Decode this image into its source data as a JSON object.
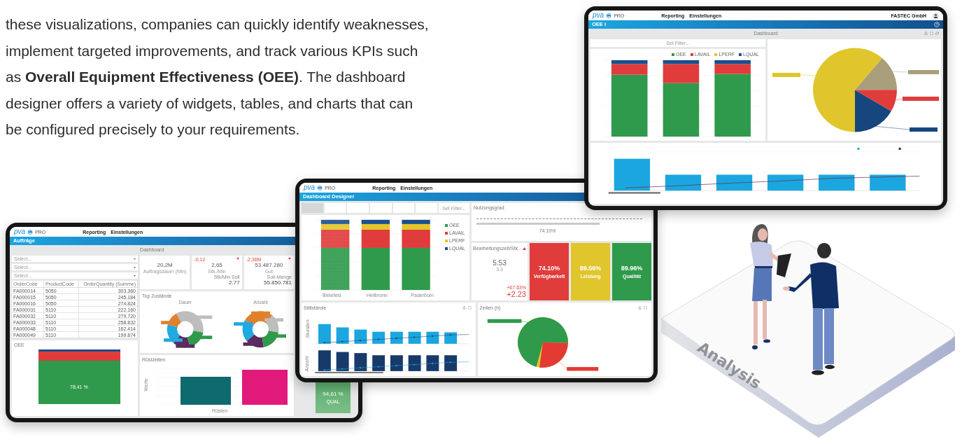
{
  "intro": {
    "lines": [
      "these visualizations, companies can quickly identify weaknesses,",
      "implement targeted improvements, and track various KPIs such",
      "as **Overall Equipment Effectiveness (OEE)**. The dashboard",
      "designer offers a variety of widgets, tables, and charts that can",
      "be configured precisely to your requirements."
    ]
  },
  "oee_tablet": {
    "header": {
      "logo": [
        "pva",
        "PRO"
      ],
      "menu": [
        "Reporting",
        "Einstellungen"
      ],
      "company": "FASTEC GmbH"
    },
    "title": "OEE I",
    "dashboard_label": "Dashboard",
    "filter": {
      "placeholder": "Set Filter..."
    },
    "legend": [
      {
        "name": "OEE",
        "color": "#2f9a4c"
      },
      {
        "name": "LAVAIL",
        "color": "#e03c3c"
      },
      {
        "name": "LPERF",
        "color": "#e3c62a"
      },
      {
        "name": "LQUAL",
        "color": "#1a4f8f"
      }
    ]
  },
  "designer_tablet": {
    "header": {
      "logo": [
        "pva",
        "PRO"
      ],
      "menu": [
        "Reporting",
        "Einstellungen"
      ]
    },
    "title": "Dashboard Designer",
    "filters": [
      {
        "selected": true
      },
      {
        "selected": false
      },
      {
        "selected": false
      },
      {
        "selected": false
      },
      {
        "selected": false
      },
      {
        "selected": false
      }
    ],
    "filter_field": {
      "placeholder": "Set Filter..."
    },
    "legend": [
      {
        "name": "OEE",
        "color": "#2f9a4c"
      },
      {
        "name": "LAVAIL",
        "color": "#e03c3c"
      },
      {
        "name": "LPERF",
        "color": "#e3c62a"
      },
      {
        "name": "LQUAL",
        "color": "#1a4f8f"
      }
    ],
    "categories": [
      "Bielefeld",
      "Heilbronn",
      "Paderborn"
    ],
    "gauge": {
      "title": "Nutzungsgrad",
      "level": 0.741,
      "reading": "74.10%"
    },
    "kpi": {
      "title": "Bearbeitungszeit/Stk.",
      "value": "5.53",
      "target": "3.3",
      "change_percent": "+67.53%",
      "change": "+2.23"
    },
    "tiles": [
      {
        "value": "74.10%",
        "label": "Verfügbarkeit",
        "color": "#e03c3c"
      },
      {
        "value": "89.56%",
        "label": "Leistung",
        "color": "#e0c62c"
      },
      {
        "value": "89.96%",
        "label": "Qualität",
        "color": "#2f9a4c"
      }
    ],
    "downtime_panel": {
      "title": "Stillstände",
      "axis_titles": [
        "Stunden",
        "Anzahl"
      ]
    },
    "times_panel": {
      "title": "Zeiten (h)"
    }
  },
  "orders_tablet": {
    "header": {
      "logo": [
        "pva",
        "PRO"
      ],
      "menu": [
        "Reporting",
        "Einstellungen"
      ]
    },
    "title": "Aufträge",
    "dashboard_label": "Dashboard",
    "selects": [
      {
        "placeholder": "Select..."
      },
      {
        "placeholder": "Select..."
      },
      {
        "placeholder": "Select..."
      }
    ],
    "table": {
      "columns": [
        "OrderCode",
        "ProductCode",
        "OrderQuantity (Summe)"
      ],
      "rows": [
        [
          "FA000014",
          "5050",
          "303.360"
        ],
        [
          "FA000015",
          "5050",
          "245.184"
        ],
        [
          "FA000016",
          "5050",
          "274.824"
        ],
        [
          "FA000031",
          "5110",
          "222.160"
        ],
        [
          "FA000032",
          "5110",
          "279.720"
        ],
        [
          "FA000033",
          "5110",
          "258.832"
        ],
        [
          "FA000048",
          "5110",
          "162.414"
        ],
        [
          "FA000049",
          "5110",
          "199.874"
        ]
      ]
    },
    "kpis": [
      {
        "value": "20,2M",
        "label": "Auftragsdauer (Min)"
      },
      {
        "delta": "-0,12",
        "value": "2,65",
        "label": "Stk./Min",
        "target_label": "Stk/Min Soll",
        "target": "2.77"
      },
      {
        "delta": "-2,36M",
        "value": "53.487.280",
        "label": "Gut",
        "target_label": "Soll-Menge",
        "target": "55.850.781"
      }
    ],
    "states_panel": {
      "title": "Top Zustände",
      "donuts": [
        {
          "title": "Dauer"
        },
        {
          "title": "Anzahl"
        }
      ]
    },
    "oee_panel": {
      "title": "OEE",
      "value": "78,41 %"
    },
    "setup_panel": {
      "title": "Rüstzeiten",
      "ylabel": "Werte",
      "category": "Rüsten"
    },
    "qual_tile": {
      "value": "94,61 %",
      "label": "QUAL"
    }
  },
  "illustration": {
    "label": "Analysis"
  }
}
